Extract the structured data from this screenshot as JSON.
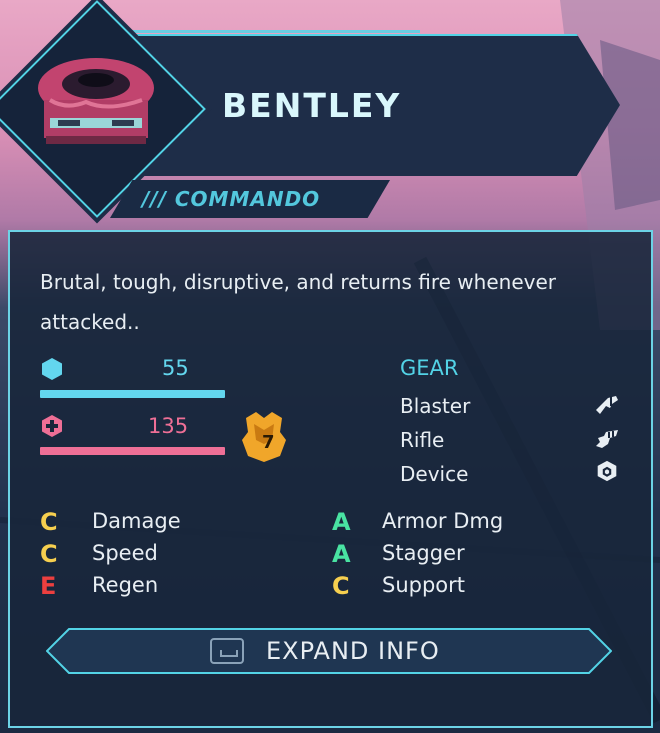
{
  "hero": {
    "name": "BENTLEY",
    "class_label": "/// COMMANDO",
    "description": "Brutal, tough, disruptive, and returns fire whenever attacked.."
  },
  "stats": {
    "shield": {
      "icon": "hexagon-shield-icon",
      "value": "55",
      "color": "#63d6ee",
      "fill": 1.0
    },
    "health": {
      "icon": "health-cross-icon",
      "value": "135",
      "color": "#ee6f96",
      "fill": 1.0
    },
    "level": {
      "icon": "level-badge-icon",
      "value": "7"
    }
  },
  "gear": {
    "title": "GEAR",
    "items": [
      {
        "label": "Blaster",
        "icon": "blaster-icon"
      },
      {
        "label": "Rifle",
        "icon": "rifle-icon"
      },
      {
        "label": "Device",
        "icon": "device-hexagon-icon"
      }
    ]
  },
  "attributes_left": [
    {
      "grade": "C",
      "label": "Damage",
      "color": "#f6cf4f"
    },
    {
      "grade": "C",
      "label": "Speed",
      "color": "#f6cf4f"
    },
    {
      "grade": "E",
      "label": "Regen",
      "color": "#ec3f3f"
    }
  ],
  "attributes_right": [
    {
      "grade": "A",
      "label": "Armor Dmg",
      "color": "#49e3a2"
    },
    {
      "grade": "A",
      "label": "Stagger",
      "color": "#49e3a2"
    },
    {
      "grade": "C",
      "label": "Support",
      "color": "#f6cf4f"
    }
  ],
  "expand_button": {
    "label": "EXPAND INFO",
    "key_icon": "keyboard-key-icon"
  },
  "colors": {
    "accent": "#53d3e6",
    "panel": "#18253a"
  }
}
